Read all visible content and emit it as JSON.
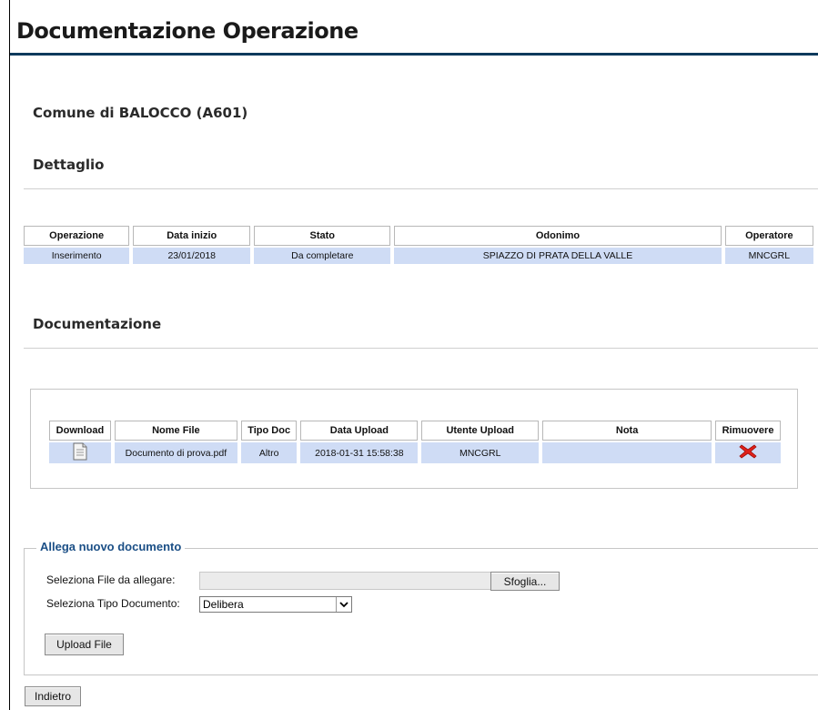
{
  "page": {
    "title": "Documentazione Operazione",
    "comune": "Comune di BALOCCO (A601)",
    "section_dettaglio": "Dettaglio",
    "section_documentazione": "Documentazione"
  },
  "dettaglio_table": {
    "headers": [
      "Operazione",
      "Data inizio",
      "Stato",
      "Odonimo",
      "Operatore"
    ],
    "rows": [
      [
        "Inserimento",
        "23/01/2018",
        "Da completare",
        "SPIAZZO DI PRATA DELLA VALLE",
        "MNCGRL"
      ]
    ]
  },
  "documents_table": {
    "headers": [
      "Download",
      "Nome File",
      "Tipo Doc",
      "Data Upload",
      "Utente Upload",
      "Nota",
      "Rimuovere"
    ],
    "rows": [
      {
        "download_icon": "file-icon",
        "nome_file": "Documento di prova.pdf",
        "tipo_doc": "Altro",
        "data_upload": "2018-01-31 15:58:38",
        "utente_upload": "MNCGRL",
        "nota": "",
        "remove_icon": "red-x-icon"
      }
    ]
  },
  "upload_form": {
    "legend": "Allega nuovo documento",
    "file_label": "Seleziona File da allegare:",
    "file_value": "",
    "browse_label": "Sfoglia...",
    "tipo_label": "Seleziona Tipo Documento:",
    "tipo_selected": "Delibera",
    "upload_button": "Upload File"
  },
  "back_button": "Indietro",
  "colors": {
    "title_rule": "#0e3a5c",
    "row_bg": "#cfdcf5",
    "legend": "#1b4f86",
    "remove_icon": "#e0201a"
  }
}
